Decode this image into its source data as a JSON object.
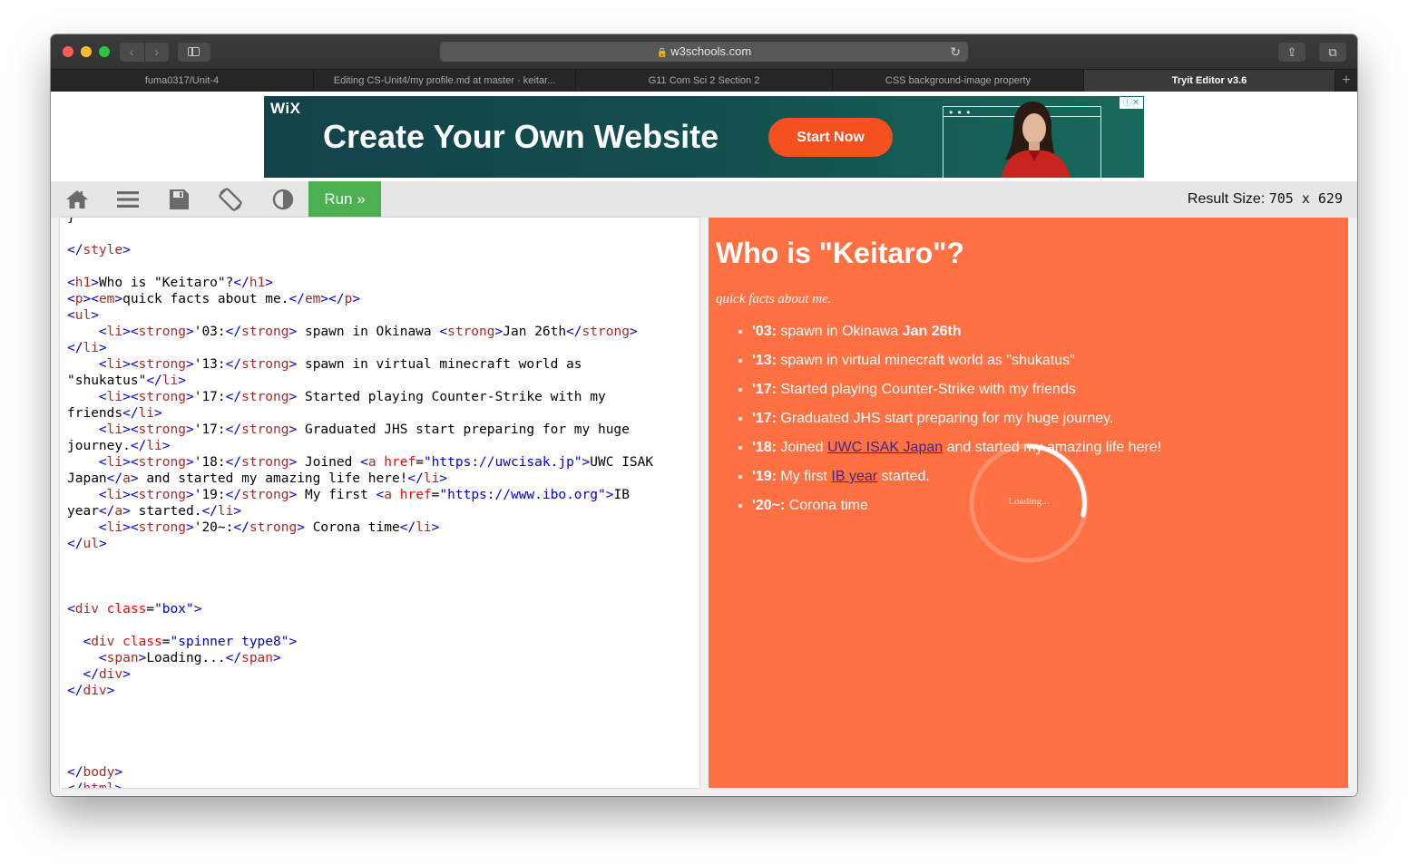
{
  "browser": {
    "url": "w3schools.com",
    "tabs": [
      {
        "label": "fuma0317/Unit-4",
        "active": false
      },
      {
        "label": "Editing CS-Unit4/my profile.md at master · keitar...",
        "active": false
      },
      {
        "label": "G11 Com Sci 2 Section 2",
        "active": false
      },
      {
        "label": "CSS background-image property",
        "active": false
      },
      {
        "label": "Tryit Editor v3.6",
        "active": true
      }
    ],
    "new_tab": "+"
  },
  "ad": {
    "brand": "WiX",
    "headline": "Create Your Own Website",
    "cta": "Start Now",
    "colors": {
      "background": "#13504f",
      "cta": "#f4511e"
    }
  },
  "toolbar": {
    "run_label": "Run »",
    "result_size_label": "Result Size:",
    "result_size_value": "705 x 629",
    "icons": [
      "home-icon",
      "menu-icon",
      "save-icon",
      "rotate-icon",
      "contrast-icon"
    ]
  },
  "editor": {
    "lines": [
      "}",
      "",
      "</style>",
      "",
      "<h1>Who is \"Keitaro\"?</h1>",
      "<p><em>quick facts about me.</em></p>",
      "<ul>",
      "    <li><strong>'03:</strong> spawn in Okinawa <strong>Jan 26th</strong>",
      "</li>",
      "    <li><strong>'13:</strong> spawn in virtual minecraft world as",
      "\"shukatus\"</li>",
      "    <li><strong>'17:</strong> Started playing Counter-Strike with my",
      "friends</li>",
      "    <li><strong>'17:</strong> Graduated JHS start preparing for my huge",
      "journey.</li>",
      "    <li><strong>'18:</strong> Joined <a href=\"https://uwcisak.jp\">UWC ISAK",
      "Japan</a> and started my amazing life here!</li>",
      "    <li><strong>'19:</strong> My first <a href=\"https://www.ibo.org\">IB",
      "year</a> started.</li>",
      "    <li><strong>'20~:</strong> Corona time</li>",
      "</ul>",
      "",
      "",
      "",
      "<div class=\"box\">",
      "",
      "  <div class=\"spinner type8\">",
      "    <span>Loading...</span>",
      "  </div>",
      "</div>",
      "",
      "",
      "",
      "",
      "</body>",
      "</html>"
    ]
  },
  "result": {
    "background": "#ff7043",
    "heading": "Who is \"Keitaro\"?",
    "tagline": "quick facts about me.",
    "items": [
      {
        "year": "'03:",
        "pre": " spawn in Okinawa ",
        "bold_tail": "Jan 26th"
      },
      {
        "year": "'13:",
        "pre": " spawn in virtual minecraft world as \"shukatus\""
      },
      {
        "year": "'17:",
        "pre": " Started playing Counter-Strike with my friends"
      },
      {
        "year": "'17:",
        "pre": " Graduated JHS start preparing for my huge journey."
      },
      {
        "year": "'18:",
        "pre": " Joined ",
        "link": "UWC ISAK Japan",
        "post": " and started my amazing life here!"
      },
      {
        "year": "'19:",
        "pre": " My first ",
        "link": "IB year",
        "post": " started."
      },
      {
        "year": "'20~:",
        "pre": " Corona time"
      }
    ],
    "spinner_text": "Loading..."
  }
}
